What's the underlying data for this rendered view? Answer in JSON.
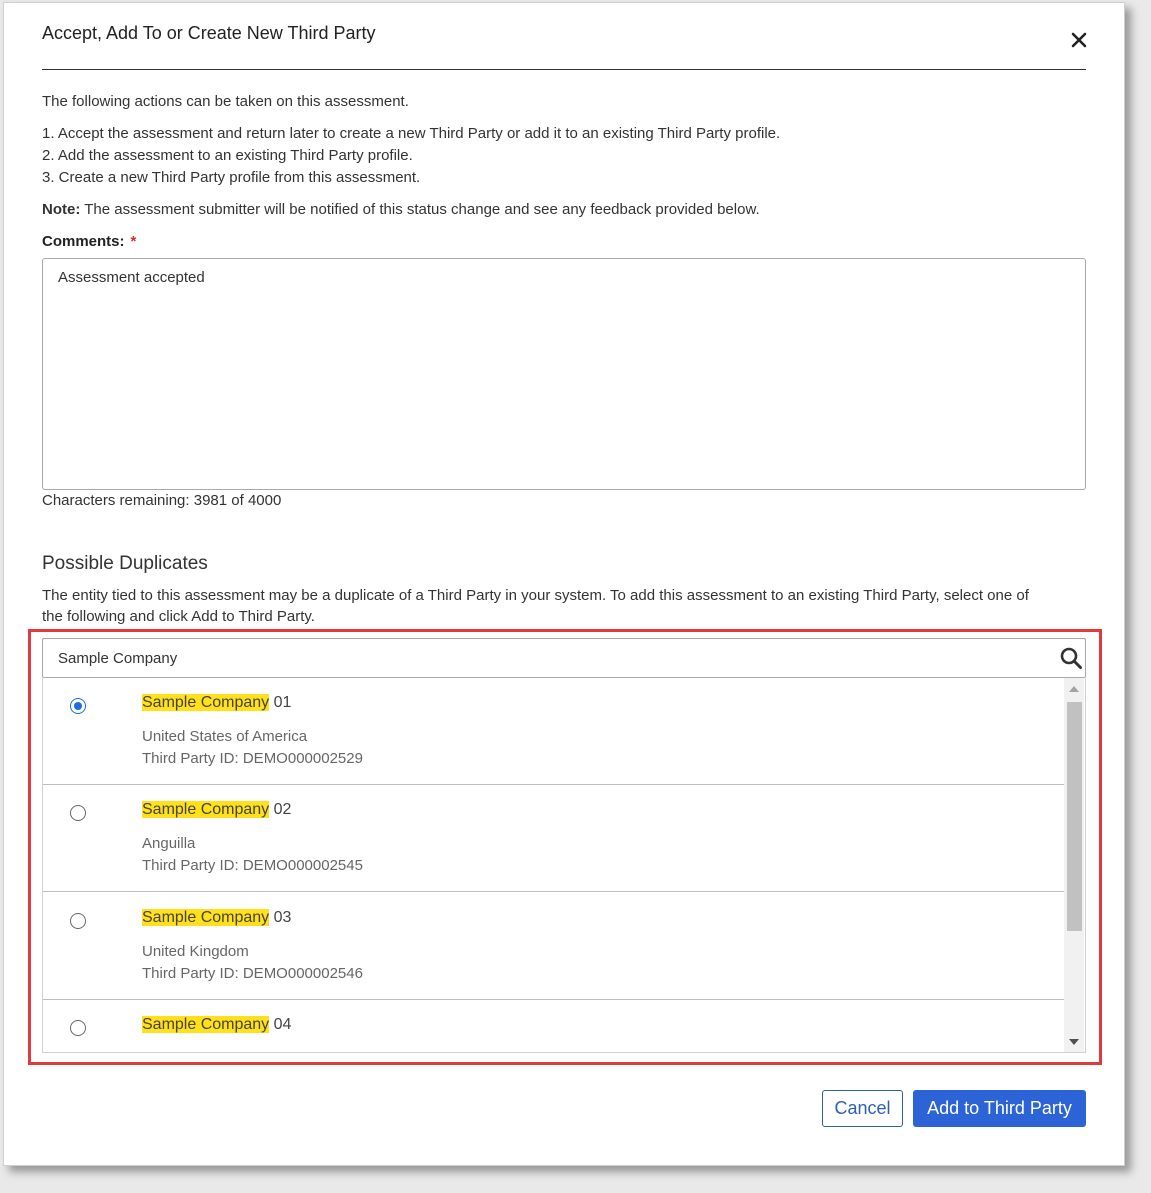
{
  "dialog": {
    "title": "Accept, Add To or Create New Third Party",
    "intro": "The following actions can be taken on this assessment.",
    "actions": [
      "1. Accept the assessment and return later to create a new Third Party or add it to an existing Third Party profile.",
      "2. Add the assessment to an existing Third Party profile.",
      "3. Create a new Third Party profile from this assessment."
    ],
    "note_label": "Note:",
    "note_text": " The assessment submitter will be notified of this status change and see any feedback provided below.",
    "comments_label": "Comments:",
    "required_marker": "*",
    "comments_value": "Assessment accepted",
    "characters_remaining": "Characters remaining: 3981 of 4000"
  },
  "duplicates": {
    "title": "Possible Duplicates",
    "description_line1": "The entity tied to this assessment may be a duplicate of a Third Party in your system. To add this assessment to an existing Third Party, select one of",
    "description_line2": "the following and click Add to Third Party.",
    "search_value": "Sample Company",
    "items": [
      {
        "match": "Sample Company",
        "suffix": " 01",
        "country": "United States of America",
        "id": "Third Party ID: DEMO000002529",
        "selected": true
      },
      {
        "match": "Sample Company",
        "suffix": " 02",
        "country": "Anguilla",
        "id": "Third Party ID: DEMO000002545",
        "selected": false
      },
      {
        "match": "Sample Company",
        "suffix": " 03",
        "country": "United Kingdom",
        "id": "Third Party ID: DEMO000002546",
        "selected": false
      },
      {
        "match": "Sample Company",
        "suffix": " 04",
        "country": "",
        "id": "",
        "selected": false
      }
    ]
  },
  "buttons": {
    "cancel": "Cancel",
    "add": "Add to Third Party"
  },
  "colors": {
    "highlight": "#ffe01a",
    "primary": "#2c63d6",
    "frame": "#e0393e",
    "radio_selected": "#1a6fe0"
  }
}
